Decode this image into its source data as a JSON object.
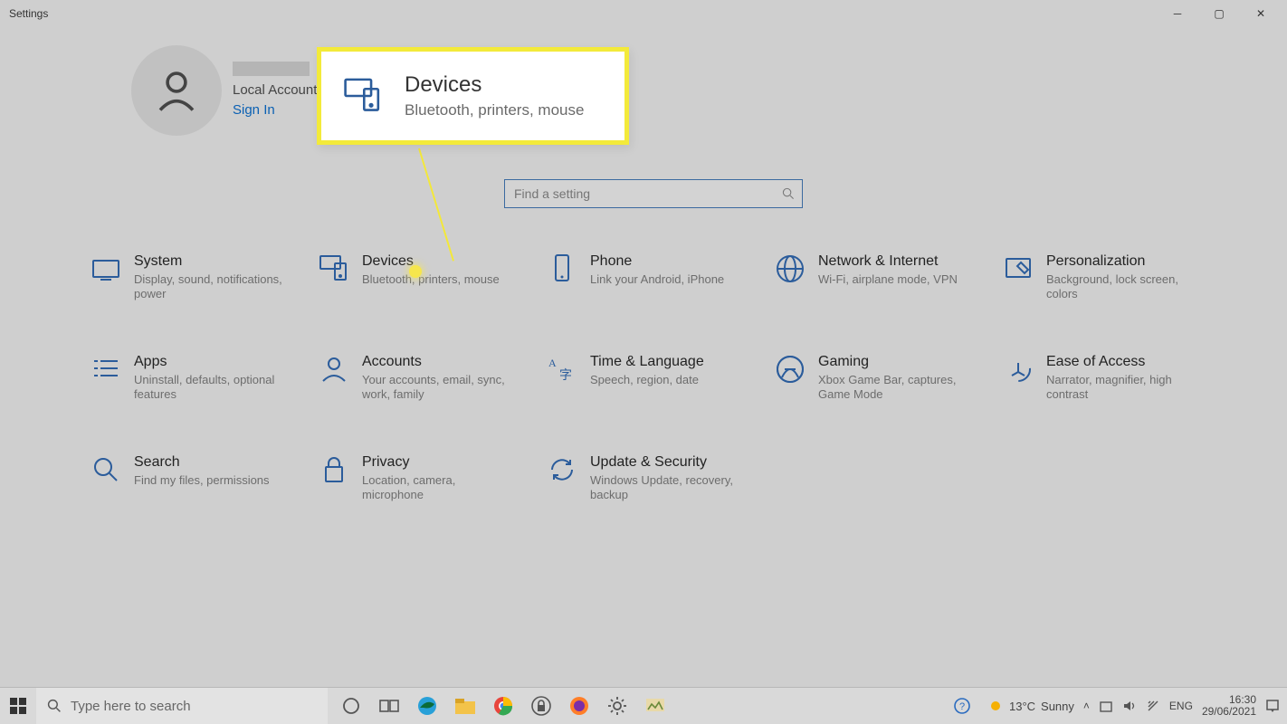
{
  "window": {
    "title": "Settings"
  },
  "user": {
    "account_type": "Local Account",
    "sign_in": "Sign In"
  },
  "search": {
    "placeholder": "Find a setting"
  },
  "callout": {
    "title": "Devices",
    "desc": "Bluetooth, printers, mouse"
  },
  "categories": [
    {
      "title": "System",
      "desc": "Display, sound, notifications, power"
    },
    {
      "title": "Devices",
      "desc": "Bluetooth, printers, mouse"
    },
    {
      "title": "Phone",
      "desc": "Link your Android, iPhone"
    },
    {
      "title": "Network & Internet",
      "desc": "Wi-Fi, airplane mode, VPN"
    },
    {
      "title": "Personalization",
      "desc": "Background, lock screen, colors"
    },
    {
      "title": "Apps",
      "desc": "Uninstall, defaults, optional features"
    },
    {
      "title": "Accounts",
      "desc": "Your accounts, email, sync, work, family"
    },
    {
      "title": "Time & Language",
      "desc": "Speech, region, date"
    },
    {
      "title": "Gaming",
      "desc": "Xbox Game Bar, captures, Game Mode"
    },
    {
      "title": "Ease of Access",
      "desc": "Narrator, magnifier, high contrast"
    },
    {
      "title": "Search",
      "desc": "Find my files, permissions"
    },
    {
      "title": "Privacy",
      "desc": "Location, camera, microphone"
    },
    {
      "title": "Update & Security",
      "desc": "Windows Update, recovery, backup"
    }
  ],
  "taskbar": {
    "search_placeholder": "Type here to search",
    "weather_temp": "13°C",
    "weather_cond": "Sunny",
    "lang": "ENG",
    "time": "16:30",
    "date": "29/06/2021"
  }
}
